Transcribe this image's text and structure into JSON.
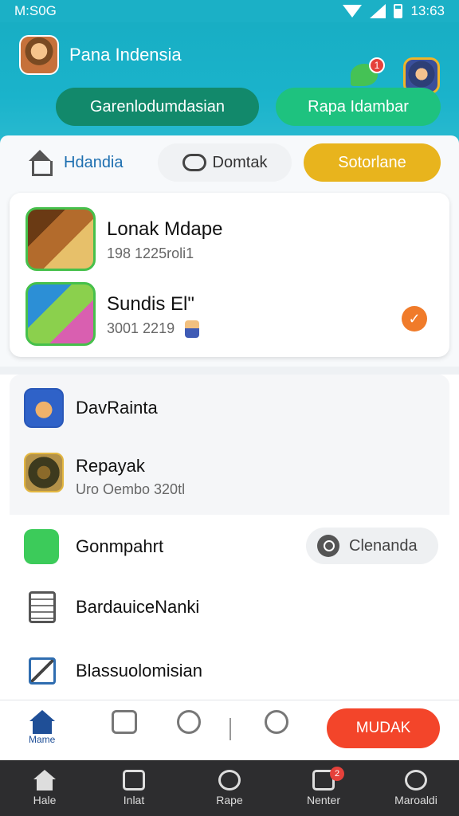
{
  "status_bar": {
    "carrier": "M:S0G",
    "time": "13:63"
  },
  "header": {
    "title": "Pana Indensia",
    "chat_badge": "1",
    "pill_left": "Garenlodumdasian",
    "pill_right": "Rapa Idambar"
  },
  "tabs": {
    "home": "Hdandia",
    "contact": "Domtak",
    "solution": "Sotorlane"
  },
  "games": [
    {
      "title": "Lonak Mdape",
      "meta": "198 1225roli1"
    },
    {
      "title": "Sundis El\"",
      "meta": "3001 2219"
    }
  ],
  "menu": {
    "item1": {
      "title": "DavRainta"
    },
    "item2": {
      "title": "Repayak",
      "sub": "Uro Oembo 320tl"
    },
    "item3": {
      "title": "Gonmpahrt"
    },
    "search_label": "Clenanda",
    "item4": {
      "title": "BardauiceNanki"
    },
    "item5": {
      "title": "Blassuolomisian"
    }
  },
  "nav_primary": {
    "home_label": "Mame",
    "action_button": "MUDAK"
  },
  "nav_bottom": [
    {
      "label": "Hale",
      "icon": "house-icon"
    },
    {
      "label": "Inlat",
      "icon": "square-icon"
    },
    {
      "label": "Rape",
      "icon": "circle-icon"
    },
    {
      "label": "Nenter",
      "icon": "message-icon",
      "badge": "2"
    },
    {
      "label": "Maroaldi",
      "icon": "person-icon"
    }
  ],
  "colors": {
    "header": "#1ab3cb",
    "accent_yellow": "#e8b41d",
    "accent_orange": "#f3452a",
    "pill_dark": "#12896b",
    "pill_light": "#1ec27f"
  }
}
